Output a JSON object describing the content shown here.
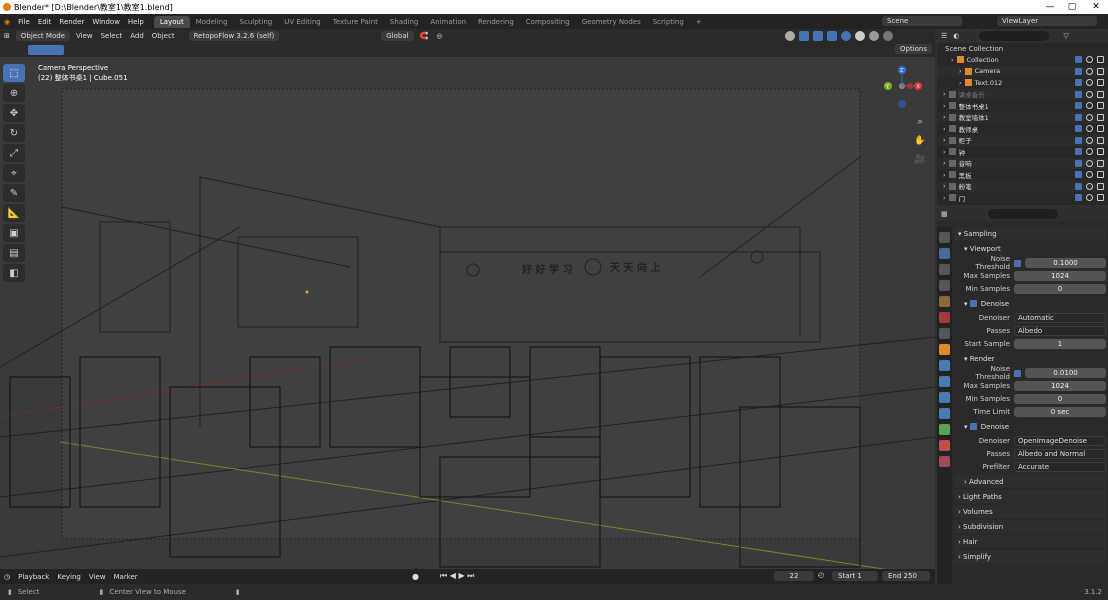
{
  "window": {
    "title": "Blender* [D:\\Blender\\教室1\\教室1.blend]",
    "min": "—",
    "max": "▢",
    "close": "✕"
  },
  "menu": [
    "File",
    "Edit",
    "Render",
    "Window",
    "Help"
  ],
  "workspaces": [
    "Layout",
    "Modeling",
    "Sculpting",
    "UV Editing",
    "Texture Paint",
    "Shading",
    "Animation",
    "Rendering",
    "Compositing",
    "Geometry Nodes",
    "Scripting"
  ],
  "active_workspace": "Layout",
  "scene": "Scene",
  "view_layer": "ViewLayer",
  "viewport_header": {
    "mode": "Object Mode",
    "menus": [
      "View",
      "Select",
      "Add",
      "Object"
    ],
    "addon": "RetopoFlow 3.2.6 (self)",
    "orientation": "Global",
    "options": "Options"
  },
  "viewport": {
    "camera_label": "Camera Perspective",
    "object_label": "(22) 整体书桌1 | Cube.051"
  },
  "scene_text": {
    "banner_left": "好 好 学 习",
    "banner_right": "天 天 向 上"
  },
  "outliner": {
    "title": "Scene Collection",
    "rows": [
      {
        "name": "Collection",
        "indent": 1,
        "color": "#ddd"
      },
      {
        "name": "Camera",
        "indent": 2,
        "color": "#ddd"
      },
      {
        "name": "Text.012",
        "indent": 2,
        "color": "#ddd"
      },
      {
        "name": "课桌备份",
        "indent": 0,
        "color": "#777"
      },
      {
        "name": "整体书桌1",
        "indent": 0,
        "color": "#ddd"
      },
      {
        "name": "教室墙体1",
        "indent": 0,
        "color": "#ddd"
      },
      {
        "name": "教师桌",
        "indent": 0,
        "color": "#ddd"
      },
      {
        "name": "柜子",
        "indent": 0,
        "color": "#ddd"
      },
      {
        "name": "钟",
        "indent": 0,
        "color": "#ddd"
      },
      {
        "name": "音响",
        "indent": 0,
        "color": "#ddd"
      },
      {
        "name": "黑板",
        "indent": 0,
        "color": "#ddd"
      },
      {
        "name": "粉笔",
        "indent": 0,
        "color": "#ddd"
      },
      {
        "name": "门",
        "indent": 0,
        "color": "#ddd"
      }
    ]
  },
  "properties": {
    "sampling": "Sampling",
    "viewport": "Viewport",
    "vp_noise_threshold_label": "Noise Threshold",
    "vp_noise_threshold": "0.1000",
    "vp_max_samples_label": "Max Samples",
    "vp_max_samples": "1024",
    "vp_min_samples_label": "Min Samples",
    "vp_min_samples": "0",
    "denoise": "Denoise",
    "vp_denoiser_label": "Denoiser",
    "vp_denoiser": "Automatic",
    "vp_passes_label": "Passes",
    "vp_passes": "Albedo",
    "vp_start_sample_label": "Start Sample",
    "vp_start_sample": "1",
    "render": "Render",
    "r_noise_threshold_label": "Noise Threshold",
    "r_noise_threshold": "0.0100",
    "r_max_samples_label": "Max Samples",
    "r_max_samples": "1024",
    "r_min_samples_label": "Min Samples",
    "r_min_samples": "0",
    "r_time_limit_label": "Time Limit",
    "r_time_limit": "0 sec",
    "r_denoise": "Denoise",
    "r_denoiser_label": "Denoiser",
    "r_denoiser": "OpenImageDenoise",
    "r_passes_label": "Passes",
    "r_passes": "Albedo and Normal",
    "r_prefilter_label": "Prefilter",
    "r_prefilter": "Accurate",
    "advanced": "Advanced",
    "light_paths": "Light Paths",
    "volumes": "Volumes",
    "subdivision": "Subdivision",
    "hair": "Hair",
    "simplify": "Simplify"
  },
  "timeline": {
    "menus": [
      "Playback",
      "Keying",
      "View",
      "Marker"
    ],
    "current_frame": "22",
    "start_label": "Start",
    "start": "1",
    "end_label": "End",
    "end": "250"
  },
  "status": {
    "select": "Select",
    "center": "Center View to Mouse",
    "version": "3.1.2"
  }
}
